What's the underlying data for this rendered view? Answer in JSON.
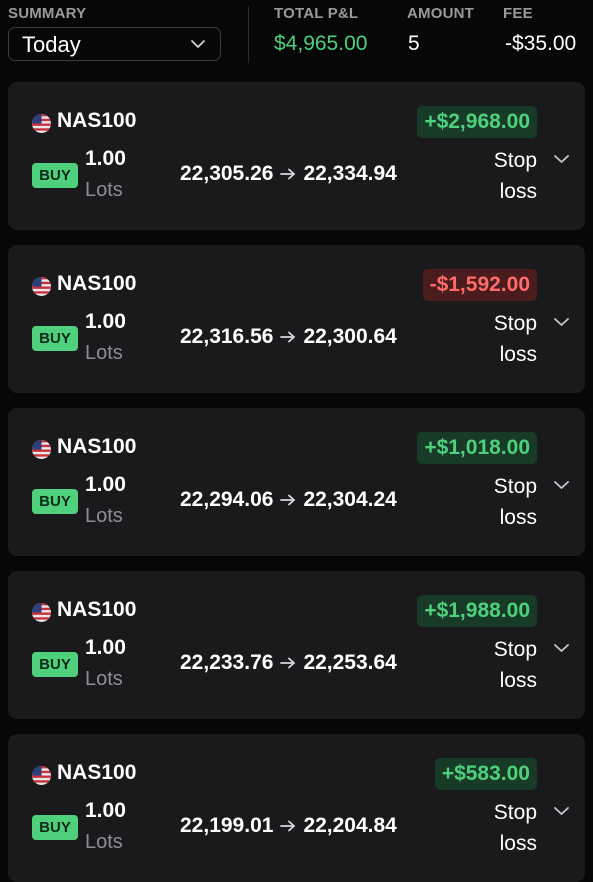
{
  "summary": {
    "label": "SUMMARY",
    "period": "Today",
    "total_pnl_label": "TOTAL P&L",
    "total_pnl": "$4,965.00",
    "amount_label": "AMOUNT",
    "amount": "5",
    "fee_label": "FEE",
    "fee": "-$35.00"
  },
  "colors": {
    "background": "#070707",
    "card": "#1a1a1c",
    "profit": "#4fd07c",
    "loss": "#ff6b6b",
    "buy_badge": "#4fd07c"
  },
  "positions": [
    {
      "symbol": "NAS100",
      "side": "BUY",
      "lots": "1.00",
      "lots_label": "Lots",
      "open_price": "22,305.26",
      "current_price": "22,334.94",
      "pnl": "+$2,968.00",
      "pnl_status": "profit",
      "stop_line1": "Stop",
      "stop_line2": "loss"
    },
    {
      "symbol": "NAS100",
      "side": "BUY",
      "lots": "1.00",
      "lots_label": "Lots",
      "open_price": "22,316.56",
      "current_price": "22,300.64",
      "pnl": "-$1,592.00",
      "pnl_status": "loss",
      "stop_line1": "Stop",
      "stop_line2": "loss"
    },
    {
      "symbol": "NAS100",
      "side": "BUY",
      "lots": "1.00",
      "lots_label": "Lots",
      "open_price": "22,294.06",
      "current_price": "22,304.24",
      "pnl": "+$1,018.00",
      "pnl_status": "profit",
      "stop_line1": "Stop",
      "stop_line2": "loss"
    },
    {
      "symbol": "NAS100",
      "side": "BUY",
      "lots": "1.00",
      "lots_label": "Lots",
      "open_price": "22,233.76",
      "current_price": "22,253.64",
      "pnl": "+$1,988.00",
      "pnl_status": "profit",
      "stop_line1": "Stop",
      "stop_line2": "loss"
    },
    {
      "symbol": "NAS100",
      "side": "BUY",
      "lots": "1.00",
      "lots_label": "Lots",
      "open_price": "22,199.01",
      "current_price": "22,204.84",
      "pnl": "+$583.00",
      "pnl_status": "profit",
      "stop_line1": "Stop",
      "stop_line2": "loss"
    }
  ],
  "icons": {
    "flag": "us-flag-icon",
    "arrow": "arrow-right-icon",
    "chevron": "chevron-down-icon"
  }
}
